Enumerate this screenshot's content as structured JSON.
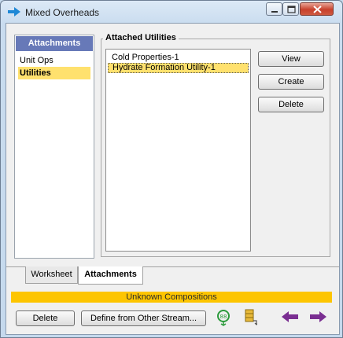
{
  "window": {
    "title": "Mixed Overheads"
  },
  "left_panel": {
    "header": "Attachments",
    "items": [
      {
        "label": "Unit Ops",
        "selected": false
      },
      {
        "label": "Utilities",
        "selected": true
      }
    ]
  },
  "group": {
    "label": "Attached Utilities",
    "utilities": [
      {
        "label": "Cold Properties-1",
        "selected": false
      },
      {
        "label": "Hydrate Formation Utility-1",
        "selected": true
      }
    ],
    "buttons": {
      "view": "View",
      "create": "Create",
      "delete": "Delete"
    }
  },
  "tabs": [
    {
      "label": "Worksheet",
      "active": false
    },
    {
      "label": "Attachments",
      "active": true
    }
  ],
  "status": {
    "text": "Unknown Compositions",
    "color": "#fdc500"
  },
  "footer": {
    "delete": "Delete",
    "define": "Define from Other Stream..."
  },
  "icons": {
    "title": "arrow-right-icon",
    "footer": [
      "stream-icon",
      "feeder-block-icon",
      "arrow-left-icon",
      "arrow-right-icon"
    ]
  },
  "colors": {
    "selection": "#ffe16e",
    "header": "#6779b8",
    "nav_arrows": "#7a2e91"
  }
}
